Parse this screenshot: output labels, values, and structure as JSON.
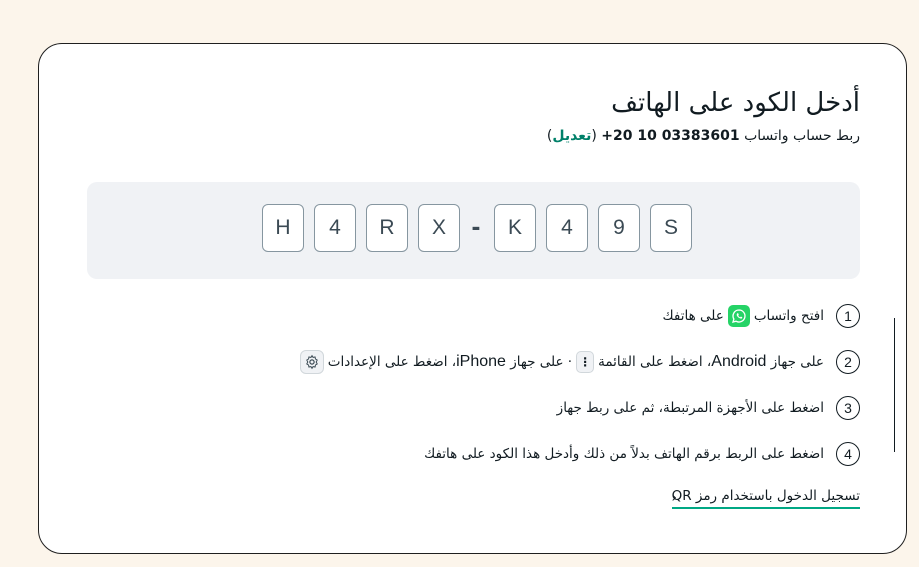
{
  "title": "أدخل الكود على الهاتف",
  "subtitle": {
    "prefix": "ربط حساب واتساب",
    "phone": "+20 10 03383601",
    "edit_open": "(",
    "edit_label": "تعديل",
    "edit_close": ")"
  },
  "code": [
    "H",
    "4",
    "R",
    "X",
    "-",
    "K",
    "4",
    "9",
    "S"
  ],
  "steps": [
    {
      "number": "1",
      "text_a": "افتح واتساب",
      "icon": "whatsapp-icon",
      "text_b": "على هاتفك"
    },
    {
      "number": "2",
      "text_a": "على جهاز",
      "android": "Android",
      "text_b": "، اضغط على القائمة",
      "menu_icon": "⋮",
      "text_c": "· على جهاز",
      "iphone": "iPhone",
      "text_d": "، اضغط على الإعدادات",
      "icon": "settings-icon"
    },
    {
      "number": "3",
      "text": "اضغط على الأجهزة المرتبطة، ثم على ربط جهاز"
    },
    {
      "number": "4",
      "text": "اضغط على الربط برقم الهاتف بدلاً من ذلك وأدخل هذا الكود على هاتفك"
    }
  ],
  "qr_link": {
    "label": "تسجيل الدخول باستخدام رمز QR",
    "chevron": "‹"
  },
  "colors": {
    "page_bg": "#fcf5eb",
    "accent": "#008069",
    "whatsapp_green": "#25d366",
    "link_underline": "#00a884"
  }
}
